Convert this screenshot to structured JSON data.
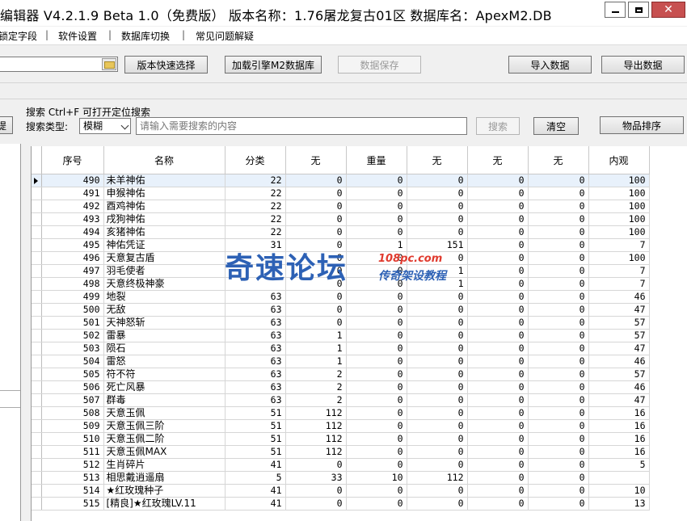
{
  "window": {
    "title": "编辑器 V4.2.1.9   Beta 1.0（免费版）   版本名称：1.76屠龙复古01区    数据库名：ApexM2.DB"
  },
  "menu": {
    "items": [
      "锁定字段",
      "软件设置",
      "数据库切换",
      "常见问题解疑"
    ],
    "separator": "|"
  },
  "toolbar": {
    "quick_select": "版本快速选择",
    "load_db": "加载引擎M2数据库",
    "save": "数据保存",
    "import": "导入数据",
    "export": "导出数据"
  },
  "search": {
    "title": "搜索  Ctrl+F 可打开定位搜索",
    "type_label": "搜索类型:",
    "type_value": "模糊",
    "placeholder": "请输入需要搜索的内容",
    "search_button": "搜索",
    "clear_button": "清空",
    "sort_button": "物品排序",
    "left_stub": "提"
  },
  "grid": {
    "columns": [
      "序号",
      "名称",
      "分类",
      "无",
      "重量",
      "无",
      "无",
      "无",
      "内观"
    ],
    "rows": [
      [
        "490",
        "未羊神佑",
        "22",
        "0",
        "0",
        "0",
        "0",
        "0",
        "100"
      ],
      [
        "491",
        "申猴神佑",
        "22",
        "0",
        "0",
        "0",
        "0",
        "0",
        "100"
      ],
      [
        "492",
        "酉鸡神佑",
        "22",
        "0",
        "0",
        "0",
        "0",
        "0",
        "100"
      ],
      [
        "493",
        "戌狗神佑",
        "22",
        "0",
        "0",
        "0",
        "0",
        "0",
        "100"
      ],
      [
        "494",
        "亥猪神佑",
        "22",
        "0",
        "0",
        "0",
        "0",
        "0",
        "100"
      ],
      [
        "495",
        "神佑凭证",
        "31",
        "0",
        "1",
        "151",
        "0",
        "0",
        "7"
      ],
      [
        "496",
        "天意复古盾",
        "",
        "0",
        "0",
        "0",
        "0",
        "0",
        "100"
      ],
      [
        "497",
        "羽毛使者",
        "",
        "0",
        "0",
        "1",
        "0",
        "0",
        "7"
      ],
      [
        "498",
        "天意终极神豪",
        "",
        "0",
        "0",
        "1",
        "0",
        "0",
        "7"
      ],
      [
        "499",
        "地裂",
        "63",
        "0",
        "0",
        "0",
        "0",
        "0",
        "46"
      ],
      [
        "500",
        "无敌",
        "63",
        "0",
        "0",
        "0",
        "0",
        "0",
        "47"
      ],
      [
        "501",
        "天神怒斩",
        "63",
        "0",
        "0",
        "0",
        "0",
        "0",
        "57"
      ],
      [
        "502",
        "雷暴",
        "63",
        "1",
        "0",
        "0",
        "0",
        "0",
        "57"
      ],
      [
        "503",
        "陨石",
        "63",
        "1",
        "0",
        "0",
        "0",
        "0",
        "47"
      ],
      [
        "504",
        "雷怒",
        "63",
        "1",
        "0",
        "0",
        "0",
        "0",
        "46"
      ],
      [
        "505",
        "符不符",
        "63",
        "2",
        "0",
        "0",
        "0",
        "0",
        "57"
      ],
      [
        "506",
        "死亡风暴",
        "63",
        "2",
        "0",
        "0",
        "0",
        "0",
        "46"
      ],
      [
        "507",
        "群毒",
        "63",
        "2",
        "0",
        "0",
        "0",
        "0",
        "47"
      ],
      [
        "508",
        "天意玉佩",
        "51",
        "112",
        "0",
        "0",
        "0",
        "0",
        "16"
      ],
      [
        "509",
        "天意玉佩三阶",
        "51",
        "112",
        "0",
        "0",
        "0",
        "0",
        "16"
      ],
      [
        "510",
        "天意玉佩二阶",
        "51",
        "112",
        "0",
        "0",
        "0",
        "0",
        "16"
      ],
      [
        "511",
        "天意玉佩MAX",
        "51",
        "112",
        "0",
        "0",
        "0",
        "0",
        "16"
      ],
      [
        "512",
        "生肖碎片",
        "41",
        "0",
        "0",
        "0",
        "0",
        "0",
        "5"
      ],
      [
        "513",
        "相思戴逍遥扇",
        "5",
        "33",
        "10",
        "112",
        "0",
        "0",
        ""
      ],
      [
        "514",
        "★红玫瑰种子",
        "41",
        "0",
        "0",
        "0",
        "0",
        "0",
        "10"
      ],
      [
        "515",
        "[精良]★红玫瑰LV.11",
        "41",
        "0",
        "0",
        "0",
        "0",
        "0",
        "13"
      ]
    ]
  },
  "watermark": {
    "main": "奇速论坛",
    "url": "108pc.com",
    "sub": "传奇架设教程"
  }
}
